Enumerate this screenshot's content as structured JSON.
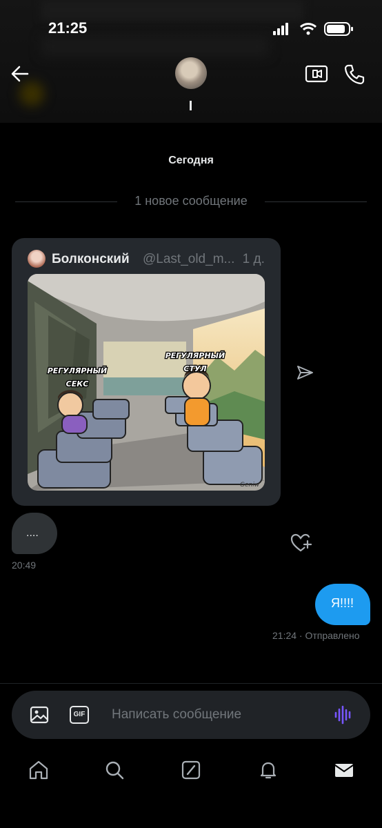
{
  "status_bar": {
    "time": "21:25"
  },
  "header": {
    "contact_name": "I"
  },
  "chat": {
    "date_separator": "Сегодня",
    "new_messages_label": "1 новое сообщение",
    "shared_post": {
      "author_name": "Болконский",
      "author_handle": "@Last_old_m...",
      "age": "1 д.",
      "meme_label_left_line1": "РЕГУЛЯРНЫЙ",
      "meme_label_left_line2": "СЕКС",
      "meme_label_right_line1": "РЕГУЛЯРНЫЙ",
      "meme_label_right_line2": "СТУЛ",
      "meme_signature": "Geniw"
    },
    "incoming": {
      "text": "....",
      "time": "20:49"
    },
    "outgoing": {
      "text": "Я!!!!",
      "time": "21:24 · Отправлено"
    }
  },
  "composer": {
    "placeholder": "Написать сообщение",
    "gif_label": "GIF"
  },
  "icons": {
    "back": "arrow-left-icon",
    "video": "video-call-icon",
    "phone": "phone-icon",
    "share": "send-icon",
    "react": "heart-plus-icon",
    "image": "image-icon",
    "gif": "gif-icon",
    "voice": "voice-wave-icon",
    "tabs": [
      "home-icon",
      "search-icon",
      "grok-icon",
      "notifications-icon",
      "messages-icon"
    ]
  },
  "colors": {
    "accent": "#1d9bf0",
    "voice_accent": "#7856ff",
    "bubble_in": "#2f3336"
  }
}
